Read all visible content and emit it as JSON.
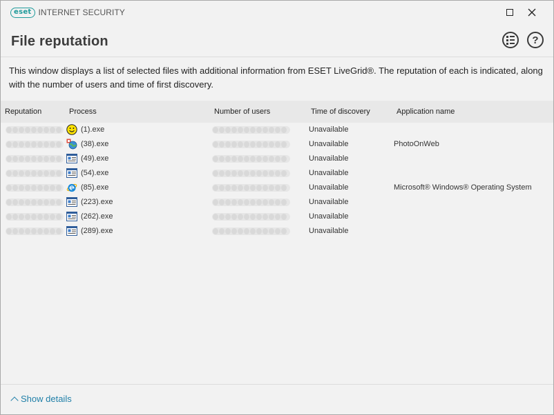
{
  "app": {
    "brand_badge": "eset",
    "product_name": "INTERNET SECURITY",
    "brand_color": "#1e9a9a"
  },
  "window_controls": {
    "maximize_icon": "maximize-icon",
    "close_icon": "close-icon"
  },
  "header": {
    "title": "File reputation",
    "list_icon": "list-view-icon",
    "help_icon": "help-icon",
    "help_glyph": "?"
  },
  "description": "This window displays a list of selected files with additional information from ESET LiveGrid®. The reputation of each is indicated, along with the number of users and time of first discovery.",
  "table": {
    "columns": [
      "Reputation",
      "Process",
      "Number of users",
      "Time of discovery",
      "Application name"
    ],
    "rows": [
      {
        "icon": "smiley-icon",
        "process": "(1).exe",
        "time": "Unavailable",
        "app": ""
      },
      {
        "icon": "photo-globe-icon",
        "process": "(38).exe",
        "time": "Unavailable",
        "app": "PhotoOnWeb"
      },
      {
        "icon": "window-app-icon",
        "process": "(49).exe",
        "time": "Unavailable",
        "app": ""
      },
      {
        "icon": "window-app-icon",
        "process": "(54).exe",
        "time": "Unavailable",
        "app": ""
      },
      {
        "icon": "internet-explorer-icon",
        "process": "(85).exe",
        "time": "Unavailable",
        "app": "Microsoft® Windows® Operating System"
      },
      {
        "icon": "window-app-icon",
        "process": "(223).exe",
        "time": "Unavailable",
        "app": ""
      },
      {
        "icon": "window-app-icon",
        "process": "(262).exe",
        "time": "Unavailable",
        "app": ""
      },
      {
        "icon": "window-app-icon",
        "process": "(289).exe",
        "time": "Unavailable",
        "app": ""
      }
    ]
  },
  "footer": {
    "show_details_label": "Show details",
    "link_color": "#1f7fa8"
  }
}
